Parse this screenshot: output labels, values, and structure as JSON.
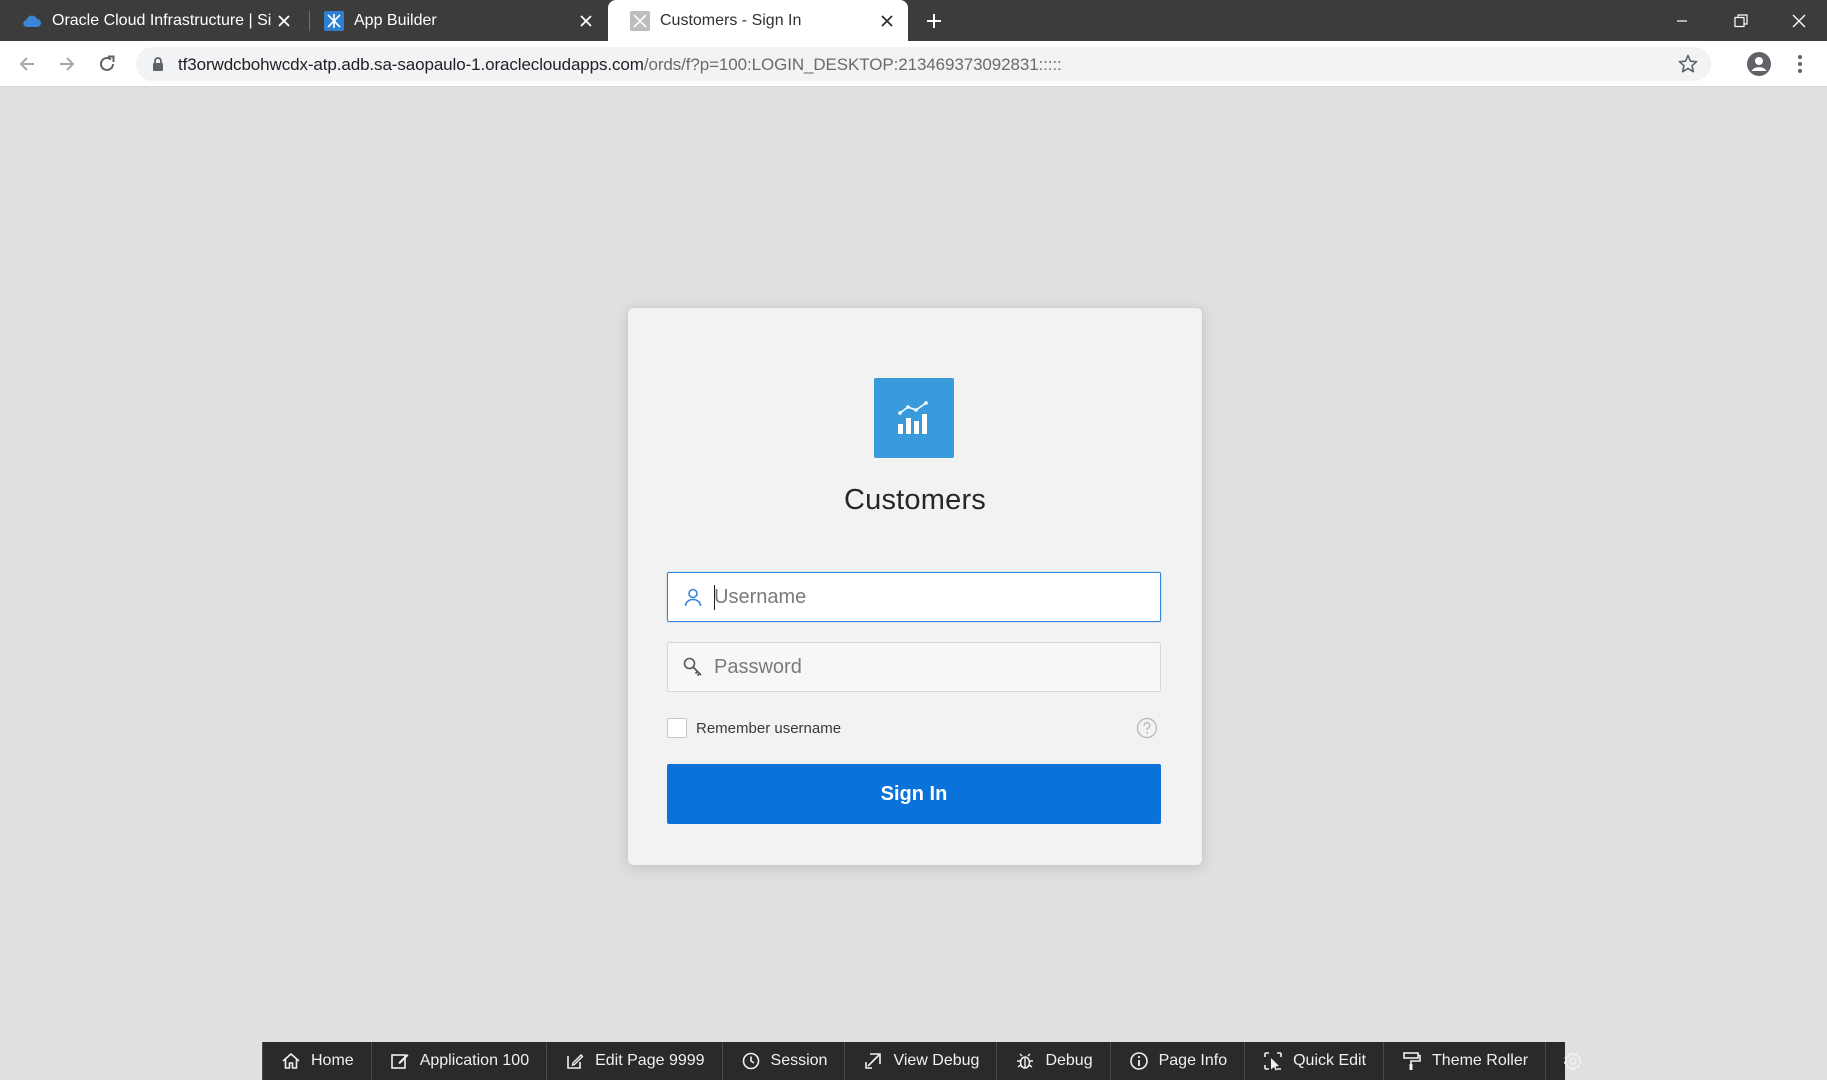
{
  "browser": {
    "tabs": [
      {
        "title": "Oracle Cloud Infrastructure | Sign",
        "favicon": "cloud-icon",
        "active": false
      },
      {
        "title": "App Builder",
        "favicon": "app-builder-icon",
        "active": false
      },
      {
        "title": "Customers - Sign In",
        "favicon": "apex-app-icon",
        "active": true
      }
    ],
    "url": {
      "domain": "tf3orwdcbohwcdx-atp.adb.sa-saopaulo-1.oraclecloudapps.com",
      "path": "/ords/f?p=100:LOGIN_DESKTOP:213469373092831:::::"
    }
  },
  "login": {
    "app_name": "Customers",
    "username_placeholder": "Username",
    "password_placeholder": "Password",
    "remember_label": "Remember username",
    "signin_label": "Sign In"
  },
  "dev_toolbar": {
    "items": [
      {
        "label": "Home",
        "icon": "home-icon"
      },
      {
        "label": "Application 100",
        "icon": "edit-app-icon"
      },
      {
        "label": "Edit Page 9999",
        "icon": "edit-page-icon"
      },
      {
        "label": "Session",
        "icon": "clock-icon"
      },
      {
        "label": "View Debug",
        "icon": "view-debug-icon"
      },
      {
        "label": "Debug",
        "icon": "bug-icon"
      },
      {
        "label": "Page Info",
        "icon": "info-icon"
      },
      {
        "label": "Quick Edit",
        "icon": "quick-edit-icon"
      },
      {
        "label": "Theme Roller",
        "icon": "paint-roller-icon"
      }
    ]
  },
  "colors": {
    "accent": "#0a72d8",
    "logo_bg": "#3a9bdc",
    "page_bg": "#e0e0e0",
    "card_bg": "#f2f2f2",
    "dev_toolbar_bg": "#2a2a2a"
  }
}
